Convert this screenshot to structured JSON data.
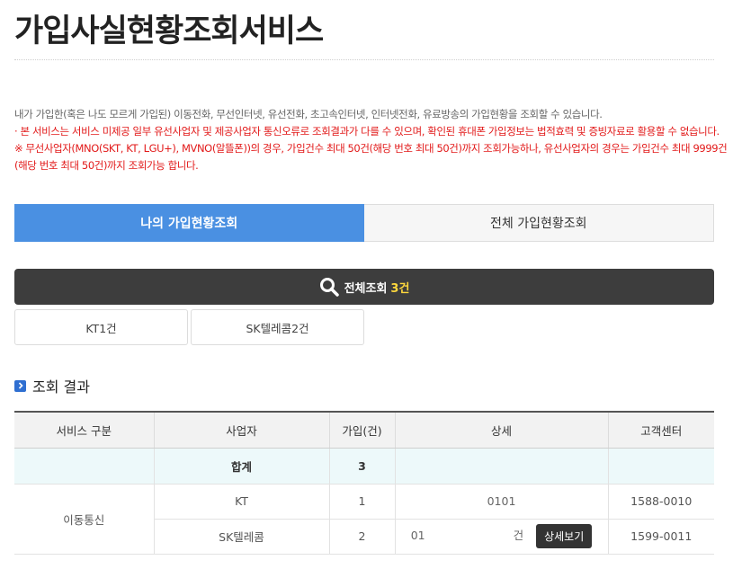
{
  "page": {
    "title": "가입사실현황조회서비스"
  },
  "description": {
    "line1": "내가 가입한(혹은 나도 모르게 가입된) 이동전화, 무선인터넷, 유선전화, 초고속인터넷, 인터넷전화, 유료방송의 가입현황을 조회할 수 있습니다.",
    "line2": "· 본 서비스는 서비스 미제공 일부 유선사업자 및 제공사업자 통신오류로 조회결과가 다를 수 있으며, 확인된 휴대폰 가입정보는 법적효력 및 증빙자료로 활용할 수 없습니다.",
    "line3": "※ 무선사업자(MNO(SKT, KT, LGU+), MVNO(알뜰폰))의 경우, 가입건수 최대 50건(해당 번호 최대 50건)까지 조회가능하나, 유선사업자의 경우는 가입건수 최대 9999건",
    "line4": "(해당 번호 최대 50건)까지 조회가능 합니다."
  },
  "tabs": [
    {
      "label": "나의 가입현황조회",
      "active": true
    },
    {
      "label": "전체 가입현황조회",
      "active": false
    }
  ],
  "total": {
    "label": "전체조회",
    "count": "3건"
  },
  "filters": [
    {
      "label": "KT1건"
    },
    {
      "label": "SK텔레콤2건"
    }
  ],
  "section": {
    "title": "조회 결과"
  },
  "table": {
    "headers": [
      "서비스 구분",
      "사업자",
      "가입(건)",
      "상세",
      "고객센터"
    ],
    "sum_row": {
      "label": "합계",
      "count": "3"
    },
    "rows": [
      {
        "service": "이동통신",
        "carrier": "KT",
        "count": "1",
        "detail": "0101",
        "center": "1588-0010"
      },
      {
        "service": "",
        "carrier": "SK텔레콤",
        "count": "2",
        "detail_prefix": "01",
        "detail_suffix": "건",
        "detail_button": "상세보기",
        "center": "1599-0011"
      }
    ]
  },
  "colors": {
    "accent": "#4a90e2",
    "dark_bar": "#3d3d3d",
    "highlight": "#ffd83d",
    "warning": "#e21a1a",
    "sum_bg": "#edf9fa"
  },
  "icons": {
    "search": "search-icon",
    "section": "chevron-right-icon"
  }
}
